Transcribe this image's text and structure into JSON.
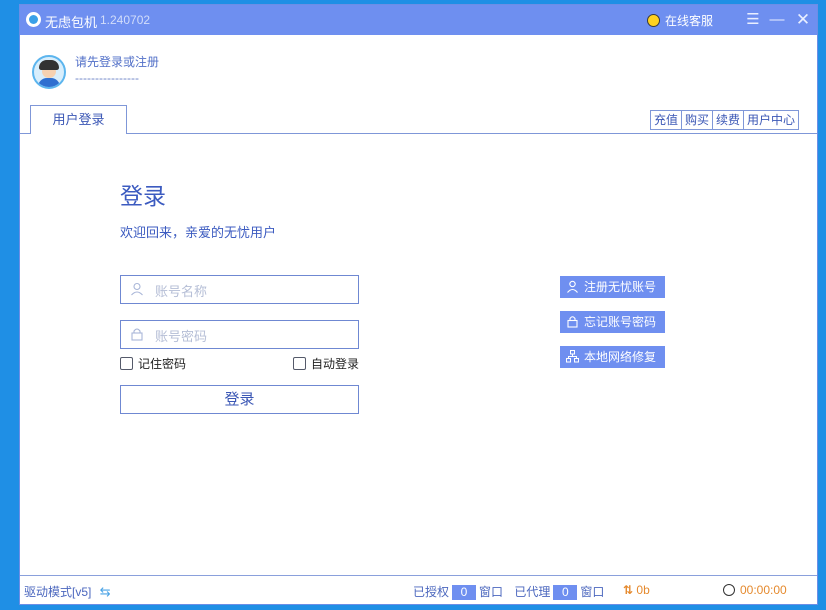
{
  "titlebar": {
    "app_name": "无虑包机",
    "version": "1.240702",
    "service_label": "在线客服"
  },
  "user": {
    "login_prompt": "请先登录或注册",
    "placeholder_line": "----------------"
  },
  "tabs": [
    {
      "label": "用户登录"
    }
  ],
  "top_menu": [
    {
      "label": "充值"
    },
    {
      "label": "购买"
    },
    {
      "label": "续费"
    },
    {
      "label": "用户中心"
    }
  ],
  "login": {
    "heading": "登录",
    "welcome": "欢迎回来，亲爱的无忧用户",
    "username_placeholder": "账号名称",
    "password_placeholder": "账号密码",
    "remember_label": "记住密码",
    "auto_login_label": "自动登录",
    "submit_label": "登录"
  },
  "side_buttons": [
    {
      "label": "注册无忧账号",
      "icon": "user-icon"
    },
    {
      "label": "忘记账号密码",
      "icon": "lock-icon"
    },
    {
      "label": "本地网络修复",
      "icon": "network-icon"
    }
  ],
  "status": {
    "driver_mode": "驱动模式[v5]",
    "authorized_label": "已授权",
    "authorized_count": "0",
    "window_label_1": "窗口",
    "proxied_label": "已代理",
    "proxied_count": "0",
    "window_label_2": "窗口",
    "traffic": "0b",
    "timer": "00:00:00"
  },
  "colors": {
    "accent": "#6e8ff0",
    "text_blue": "#3c5bc0",
    "status_orange": "#e58a2e",
    "desktop": "#1f8fe5"
  }
}
